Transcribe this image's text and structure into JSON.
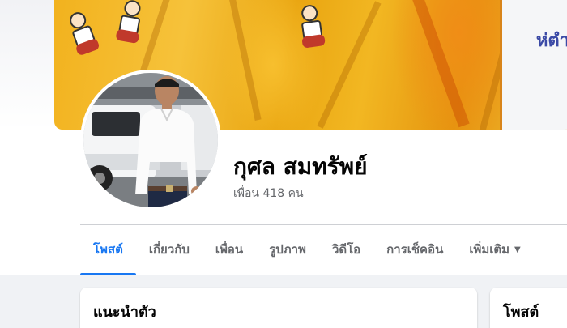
{
  "profile": {
    "name": "กุศล สมทรัพย์",
    "friends_text": "เพื่อน 418 คน"
  },
  "cover": {
    "sign_text": "ห่ตำ"
  },
  "tabs": [
    {
      "label": "โพสต์",
      "active": true
    },
    {
      "label": "เกี่ยวกับ",
      "active": false
    },
    {
      "label": "เพื่อน",
      "active": false
    },
    {
      "label": "รูปภาพ",
      "active": false
    },
    {
      "label": "วิดีโอ",
      "active": false
    },
    {
      "label": "การเช็คอิน",
      "active": false
    },
    {
      "label": "เพิ่มเติม",
      "active": false,
      "icon": "caret-down-icon"
    }
  ],
  "cards": {
    "intro_title": "แนะนำตัว",
    "posts_title": "โพสต์"
  },
  "colors": {
    "accent": "#1877f2",
    "text_primary": "#050505",
    "text_secondary": "#65676b",
    "feed_background": "#f0f2f5",
    "cover_orange": "#f2b21e"
  }
}
